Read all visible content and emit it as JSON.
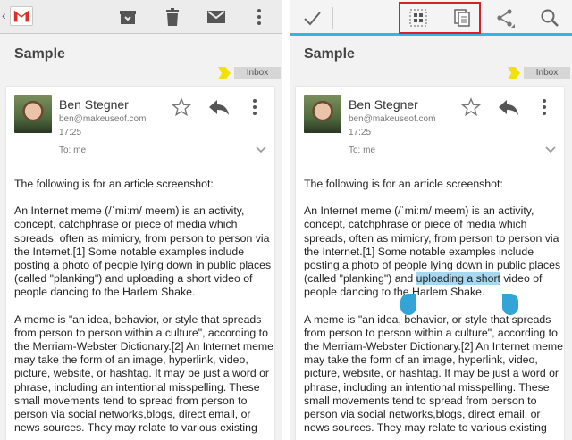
{
  "left": {
    "subject": "Sample",
    "label": "Inbox",
    "sender": {
      "name": "Ben Stegner",
      "email": "ben@makeuseof.com",
      "time": "17:25",
      "to": "To: me"
    },
    "actions": [
      "back-icon",
      "gmail-logo",
      "archive-icon",
      "delete-icon",
      "mark-unread-icon",
      "more-icon"
    ],
    "body": {
      "p1": "The following is for an article screenshot:",
      "p2": "An Internet meme (/ˈmiːm/ meem) is an activity, concept, catchphrase or piece of media which spreads, often as mimicry, from person to person via the Internet.[1] Some notable examples include posting a photo of people lying down in public places (called \"planking\") and uploading a short video of people dancing to the Harlem Shake.",
      "p3": "A meme is \"an idea, behavior, or style that spreads from person to person within a culture\", according to the Merriam-Webster Dictionary.[2] An Internet meme may take the form of an image, hyperlink, video, picture, website, or hashtag. It may be just a word or phrase, including an intentional misspelling. These small movements tend to spread from person to person via social networks,blogs, direct email, or news sources. They may relate to various existing"
    }
  },
  "right": {
    "subject": "Sample",
    "label": "Inbox",
    "sender": {
      "name": "Ben Stegner",
      "email": "ben@makeuseof.com",
      "time": "17:25",
      "to": "To: me"
    },
    "actions": [
      "done-check-icon",
      "select-all-icon",
      "copy-icon",
      "share-icon",
      "search-icon"
    ],
    "body": {
      "p1": "The following is for an article screenshot:",
      "p2_before": "An Internet meme (/ˈmiːm/ meem) is an activity, concept, catchphrase or piece of media which spreads, often as mimicry, from person to person via the Internet.[1] Some notable examples include posting a photo of people lying down in public places (called \"planking\") and ",
      "p2_selected": "uploading a short",
      "p2_after": " video of people dancing to the Harlem Shake.",
      "p3": "A meme is \"an idea, behavior, or style that spreads from person to person within a culture\", according to the Merriam-Webster Dictionary.[2] An Internet meme may take the form of an image, hyperlink, video, picture, website, or hashtag. It may be just a word or phrase, including an intentional misspelling. These small movements tend to spread from person to person via social networks,blogs, direct email, or news sources. They may relate to various existing"
    }
  },
  "colors": {
    "accent": "#33b5e5",
    "selection": "#a8d8f0",
    "handle": "#33a4d6",
    "highlight_box": "#d8202a",
    "label_arrow": "#f3e200"
  }
}
